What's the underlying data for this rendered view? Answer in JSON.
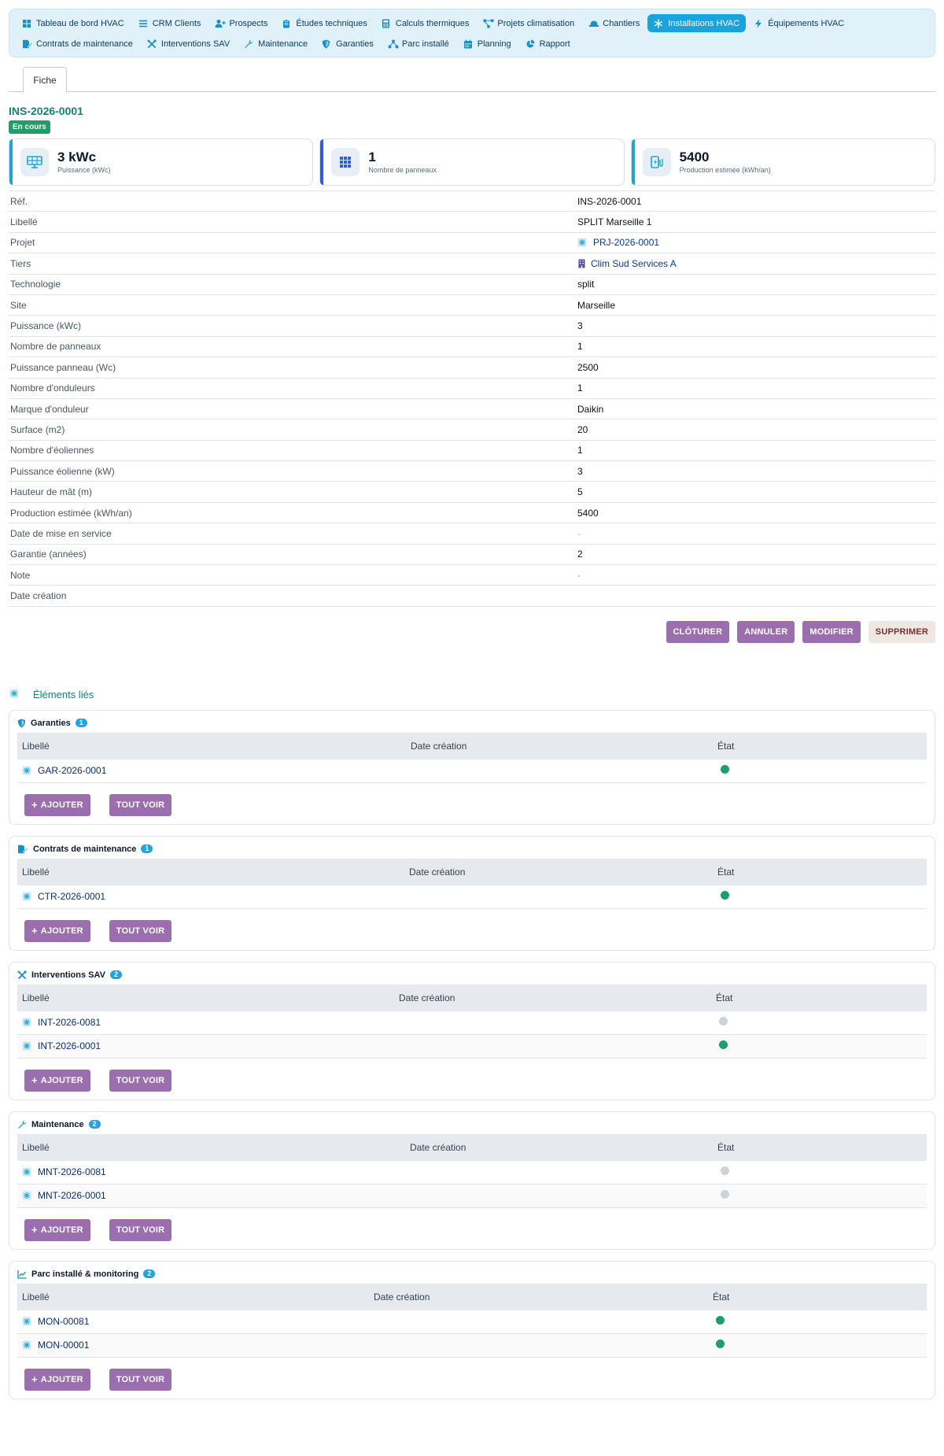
{
  "nav": {
    "items": [
      {
        "label": "Tableau de bord HVAC",
        "icon": "grid-icon"
      },
      {
        "label": "CRM Clients",
        "icon": "list-icon"
      },
      {
        "label": "Prospects",
        "icon": "user-plus-icon"
      },
      {
        "label": "Études techniques",
        "icon": "clipboard-icon"
      },
      {
        "label": "Calculs thermiques",
        "icon": "calculator-icon"
      },
      {
        "label": "Projets climatisation",
        "icon": "project-diagram-icon"
      },
      {
        "label": "Chantiers",
        "icon": "hard-hat-icon"
      },
      {
        "label": "Installations HVAC",
        "icon": "snowflake-icon",
        "active": true
      },
      {
        "label": "Équipements HVAC",
        "icon": "bolt-icon"
      },
      {
        "label": "Contrats de maintenance",
        "icon": "file-signature-icon"
      },
      {
        "label": "Interventions SAV",
        "icon": "tools-icon"
      },
      {
        "label": "Maintenance",
        "icon": "wrench-icon"
      },
      {
        "label": "Garanties",
        "icon": "shield-icon"
      },
      {
        "label": "Parc installé",
        "icon": "network-icon"
      },
      {
        "label": "Planning",
        "icon": "calendar-icon"
      },
      {
        "label": "Rapport",
        "icon": "chart-pie-icon"
      }
    ]
  },
  "tabs": {
    "fiche": "Fiche"
  },
  "record": {
    "ref": "INS-2026-0001",
    "status": "En cours"
  },
  "kpis": [
    {
      "value": "3 kWc",
      "label": "Puissance (kWc)",
      "icon": "solar-panel-icon"
    },
    {
      "value": "1",
      "label": "Nombre de panneaux",
      "icon": "grid-icon"
    },
    {
      "value": "5400",
      "label": "Production estimée (kWh/an)",
      "icon": "charging-station-icon"
    }
  ],
  "fields": [
    {
      "label": "Réf.",
      "value": "INS-2026-0001"
    },
    {
      "label": "Libellé",
      "value": "SPLIT Marseille 1"
    },
    {
      "label": "Projet",
      "value": "PRJ-2026-0001",
      "link": true,
      "icon": "snowflake-icon"
    },
    {
      "label": "Tiers",
      "value": "Clim Sud Services A",
      "link": true,
      "icon": "building-icon"
    },
    {
      "label": "Technologie",
      "value": "split"
    },
    {
      "label": "Site",
      "value": "Marseille"
    },
    {
      "label": "Puissance (kWc)",
      "value": "3"
    },
    {
      "label": "Nombre de panneaux",
      "value": "1"
    },
    {
      "label": "Puissance panneau (Wc)",
      "value": "2500"
    },
    {
      "label": "Nombre d'onduleurs",
      "value": "1"
    },
    {
      "label": "Marque d'onduleur",
      "value": "Daikin"
    },
    {
      "label": "Surface (m2)",
      "value": "20"
    },
    {
      "label": "Nombre d'éoliennes",
      "value": "1"
    },
    {
      "label": "Puissance éolienne (kW)",
      "value": "3"
    },
    {
      "label": "Hauteur de mât (m)",
      "value": "5"
    },
    {
      "label": "Production estimée (kWh/an)",
      "value": "5400"
    },
    {
      "label": "Date de mise en service",
      "value": "-",
      "muted": true
    },
    {
      "label": "Garantie (années)",
      "value": "2"
    },
    {
      "label": "Note",
      "value": "-",
      "muted": true
    },
    {
      "label": "Date création",
      "value": ""
    }
  ],
  "actions": {
    "close": "CLÔTURER",
    "cancel": "ANNULER",
    "edit": "MODIFIER",
    "delete": "SUPPRIMER"
  },
  "linked": {
    "title": "Éléments liés",
    "columns": {
      "label": "Libellé",
      "date": "Date création",
      "state": "État"
    },
    "add_label": "AJOUTER",
    "view_all_label": "TOUT VOIR",
    "sections": [
      {
        "title": "Garanties",
        "icon": "shield-icon",
        "count": "1",
        "date_col": 500,
        "state_col": 390,
        "rows": [
          {
            "ref": "GAR-2026-0001",
            "state": "green"
          }
        ]
      },
      {
        "title": "Contrats de maintenance",
        "icon": "file-signature-icon",
        "count": "1",
        "date_col": 498,
        "state_col": 392,
        "rows": [
          {
            "ref": "CTR-2026-0001",
            "state": "green"
          }
        ]
      },
      {
        "title": "Interventions SAV",
        "icon": "tools-icon",
        "count": "2",
        "date_col": 485,
        "state_col": 403,
        "rows": [
          {
            "ref": "INT-2026-0081",
            "state": "grey"
          },
          {
            "ref": "INT-2026-0001",
            "state": "green"
          }
        ]
      },
      {
        "title": "Maintenance",
        "icon": "wrench-icon",
        "count": "2",
        "date_col": 499,
        "state_col": 391,
        "rows": [
          {
            "ref": "MNT-2026-0081",
            "state": "grey"
          },
          {
            "ref": "MNT-2026-0001",
            "state": "grey"
          }
        ]
      },
      {
        "title": "Parc installé & monitoring",
        "icon": "chart-line-icon",
        "count": "2",
        "date_col": 453,
        "state_col": 431,
        "rows": [
          {
            "ref": "MON-00081",
            "state": "green"
          },
          {
            "ref": "MON-00001",
            "state": "green"
          }
        ]
      }
    ]
  },
  "colors": {
    "accent": "#1aa3da",
    "brand_green": "#1a7f73",
    "button_purple": "#9b6fae",
    "status_green": "#1f9d6a",
    "status_grey": "#cfd3d7"
  }
}
